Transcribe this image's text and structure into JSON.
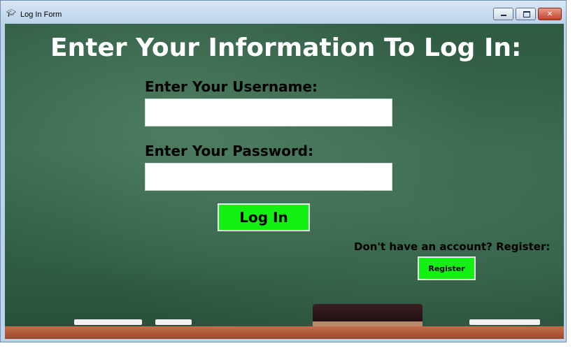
{
  "window": {
    "title": "Log In Form",
    "icon": "graduation-cap-icon"
  },
  "form": {
    "heading": "Enter Your Information To Log In:",
    "username_label": "Enter Your Username:",
    "username_value": "",
    "password_label": "Enter Your Password:",
    "password_value": "",
    "login_button": "Log In",
    "register_prompt": "Don't have an account? Register:",
    "register_button": "Register"
  },
  "colors": {
    "chalkboard": "#2f5b43",
    "button_green": "#14f014",
    "heading_text": "#ffffff"
  }
}
